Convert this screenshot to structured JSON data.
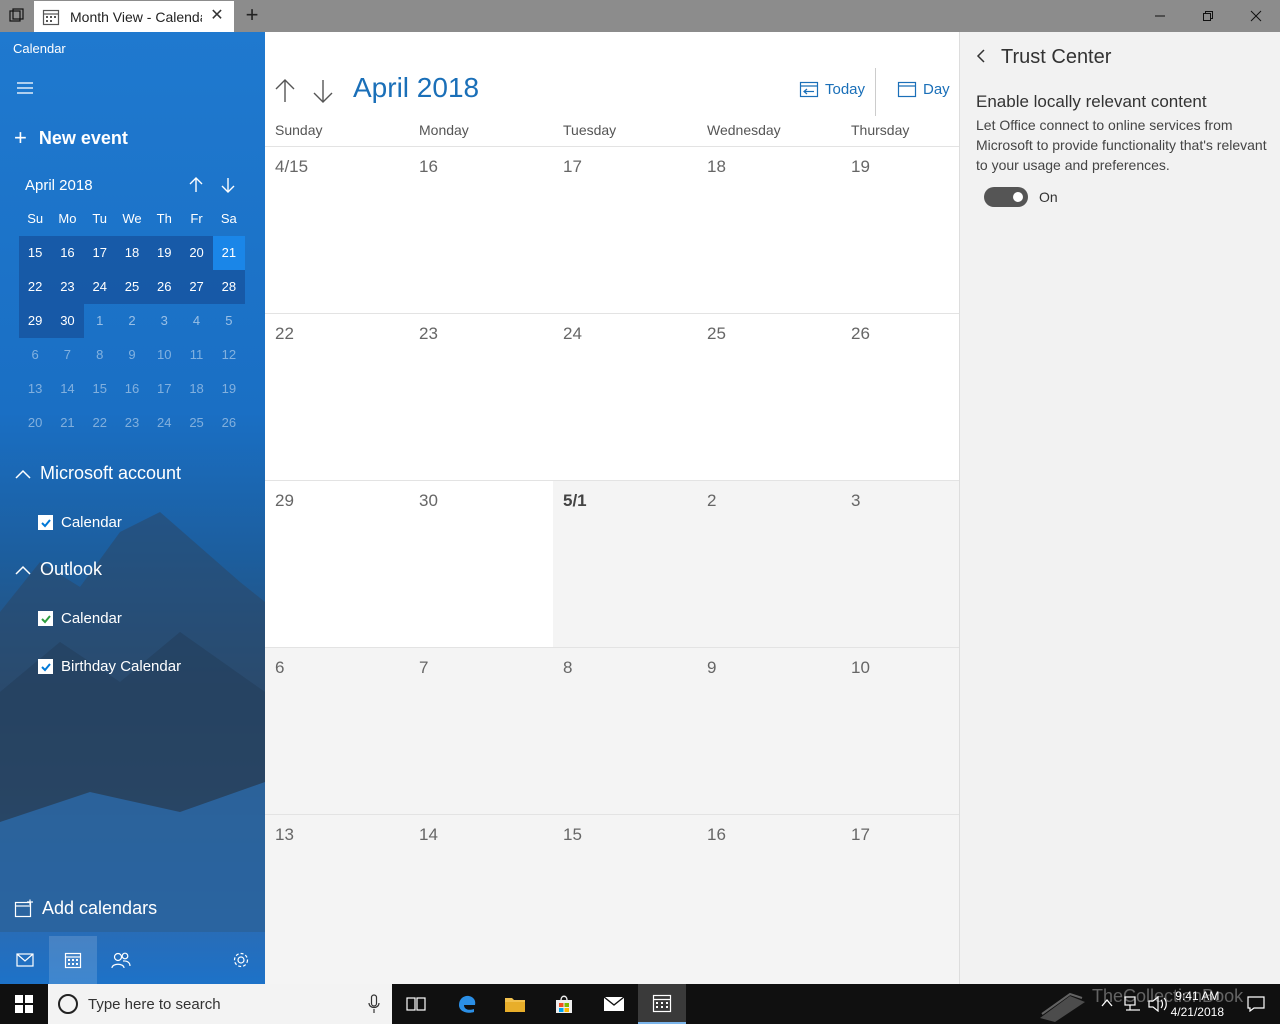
{
  "window": {
    "tab_title": "Month View - Calendar"
  },
  "sidebar": {
    "app_name": "Calendar",
    "new_event_label": "New event",
    "mini_calendar": {
      "title": "April 2018",
      "day_headers": [
        "Su",
        "Mo",
        "Tu",
        "We",
        "Th",
        "Fr",
        "Sa"
      ],
      "rows": [
        [
          "15",
          "16",
          "17",
          "18",
          "19",
          "20",
          "21"
        ],
        [
          "22",
          "23",
          "24",
          "25",
          "26",
          "27",
          "28"
        ],
        [
          "29",
          "30",
          "1",
          "2",
          "3",
          "4",
          "5"
        ],
        [
          "6",
          "7",
          "8",
          "9",
          "10",
          "11",
          "12"
        ],
        [
          "13",
          "14",
          "15",
          "16",
          "17",
          "18",
          "19"
        ],
        [
          "20",
          "21",
          "22",
          "23",
          "24",
          "25",
          "26"
        ]
      ],
      "selected_day": "21"
    },
    "groups": [
      {
        "name": "Microsoft account",
        "calendars": [
          {
            "name": "Calendar",
            "checked": true,
            "color": "#0078d7"
          }
        ]
      },
      {
        "name": "Outlook",
        "calendars": [
          {
            "name": "Calendar",
            "checked": true,
            "color": "#2e9e3e"
          },
          {
            "name": "Birthday Calendar",
            "checked": true,
            "color": "#0078d7"
          }
        ]
      }
    ],
    "add_calendars_label": "Add calendars",
    "nav_icons": [
      "mail-icon",
      "calendar-icon",
      "people-icon",
      "settings-icon"
    ]
  },
  "main": {
    "month_title": "April 2018",
    "today_label": "Today",
    "day_label": "Day",
    "day_headers": [
      "Sunday",
      "Monday",
      "Tuesday",
      "Wednesday",
      "Thursday"
    ],
    "weeks": [
      [
        "4/15",
        "16",
        "17",
        "18",
        "19"
      ],
      [
        "22",
        "23",
        "24",
        "25",
        "26"
      ],
      [
        "29",
        "30",
        "5/1",
        "2",
        "3"
      ],
      [
        "6",
        "7",
        "8",
        "9",
        "10"
      ],
      [
        "13",
        "14",
        "15",
        "16",
        "17"
      ]
    ]
  },
  "panel": {
    "title": "Trust Center",
    "setting_title": "Enable locally relevant content",
    "setting_desc": "Let Office connect to online services from Microsoft to provide functionality that's relevant to your usage and preferences.",
    "toggle_label": "On",
    "toggle_on": true
  },
  "taskbar": {
    "search_placeholder": "Type here to search",
    "time": "9:41 AM",
    "date": "4/21/2018",
    "watermark": "TheCollectionBook"
  },
  "colors": {
    "accent": "#1a6fb8",
    "sidebar": "#1f79cf",
    "today_cell": "#1a86e8"
  }
}
